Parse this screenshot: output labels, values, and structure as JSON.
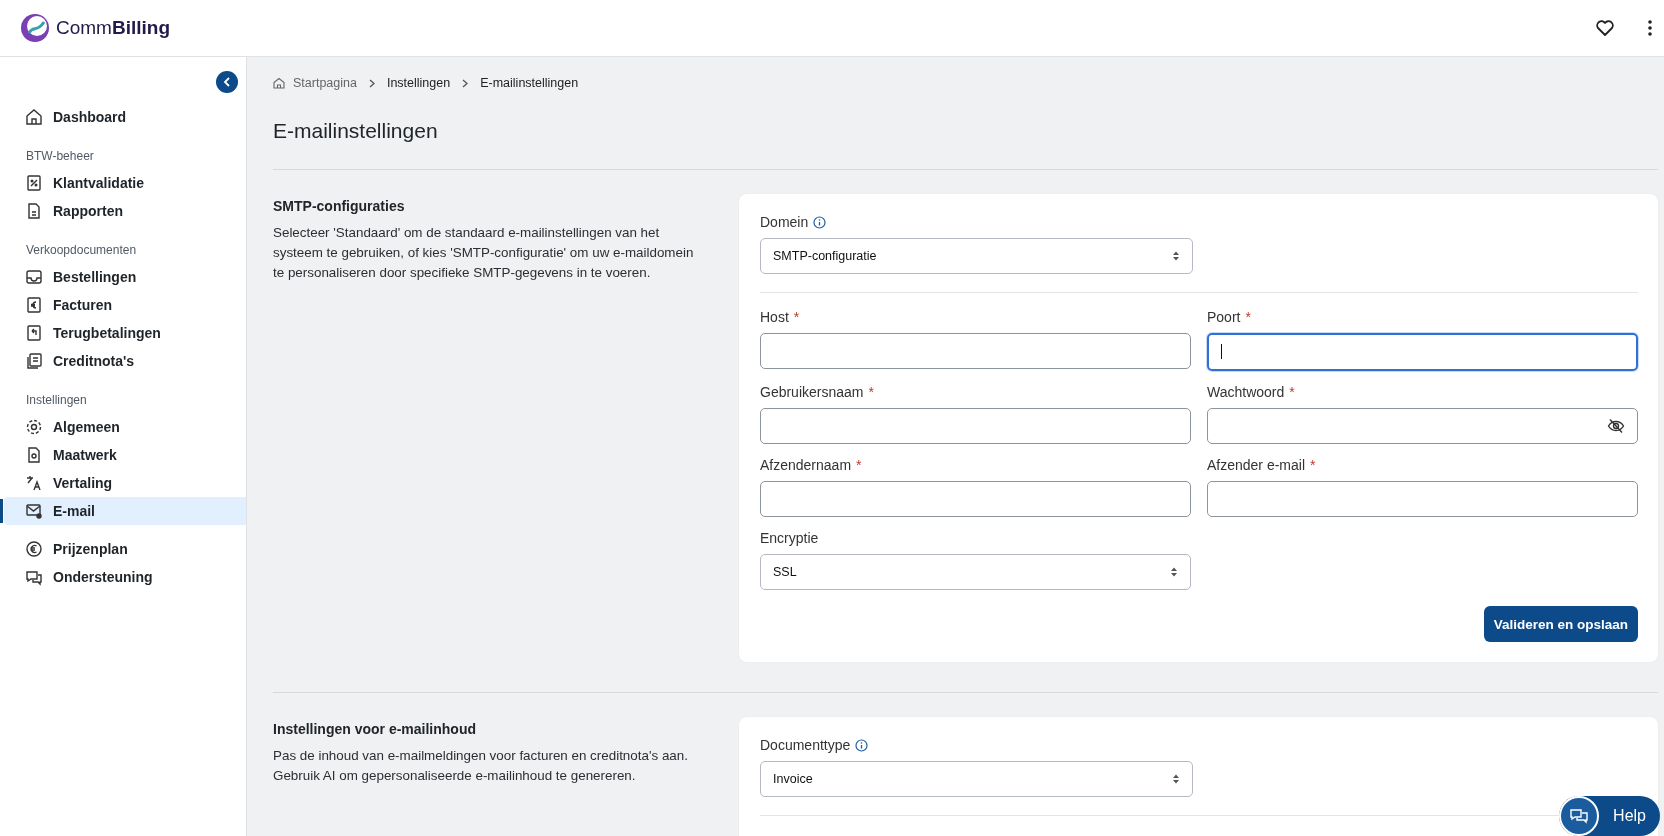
{
  "header": {
    "logo_text": "Comm**Billing**"
  },
  "sidebar": {
    "groups": [
      {
        "items": [
          {
            "label": "Dashboard",
            "selected": false
          }
        ]
      },
      {
        "heading": "BTW-beheer",
        "items": [
          {
            "label": "Klantvalidatie",
            "selected": false
          },
          {
            "label": "Rapporten",
            "selected": false
          }
        ]
      },
      {
        "heading": "Verkoopdocumenten",
        "items": [
          {
            "label": "Bestellingen",
            "selected": false
          },
          {
            "label": "Facturen",
            "selected": false
          },
          {
            "label": "Terugbetalingen",
            "selected": false
          },
          {
            "label": "Creditnota's",
            "selected": false
          }
        ]
      },
      {
        "heading": "Instellingen",
        "items": [
          {
            "label": "Algemeen",
            "selected": false
          },
          {
            "label": "Maatwerk",
            "selected": false
          },
          {
            "label": "Vertaling",
            "selected": false
          },
          {
            "label": "E-mail",
            "selected": true
          }
        ]
      },
      {
        "items": [
          {
            "label": "Prijzenplan",
            "selected": false
          },
          {
            "label": "Ondersteuning",
            "selected": false
          }
        ]
      }
    ]
  },
  "breadcrumb": [
    "Startpagina",
    "Instellingen",
    "E-mailinstellingen"
  ],
  "page_title": "E-mailinstellingen",
  "sections": [
    {
      "title": "SMTP-configuraties",
      "description": "Selecteer 'Standaard' om de standaard e-mailinstellingen van het systeem te gebruiken, of kies 'SMTP-configuratie' om uw e-maildomein te personaliseren door specifieke SMTP-gegevens in te voeren.",
      "top_field": {
        "label": "Domein",
        "kind": "select",
        "value": "SMTP-configuratie",
        "info": true
      },
      "fields": [
        {
          "label": "Host",
          "required_mark": "*",
          "kind": "text",
          "focused": false
        },
        {
          "label": "Poort",
          "required_mark": "*",
          "kind": "text",
          "focused": true
        },
        {
          "label": "Gebruikersnaam",
          "required_mark": "*",
          "kind": "text",
          "focused": false
        },
        {
          "label": "Wachtwoord",
          "required_mark": "*",
          "kind": "password",
          "focused": false
        },
        {
          "label": "Afzendernaam",
          "required_mark": "*",
          "kind": "text",
          "focused": false
        },
        {
          "label": "Afzender e-mail",
          "required_mark": "*",
          "kind": "text",
          "focused": false
        },
        {
          "label": "Encryptie",
          "kind": "select",
          "value": "SSL"
        }
      ],
      "button": "Valideren en opslaan"
    },
    {
      "title": "Instellingen voor e-mailinhoud",
      "description": "Pas de inhoud van e-mailmeldingen voor facturen en creditnota's aan. Gebruik AI om gepersonaliseerde e-mailinhoud te genereren.",
      "top_field": {
        "label": "Documenttype",
        "kind": "select",
        "value": "Invoice",
        "info": true
      }
    }
  ],
  "help_button": "Help"
}
